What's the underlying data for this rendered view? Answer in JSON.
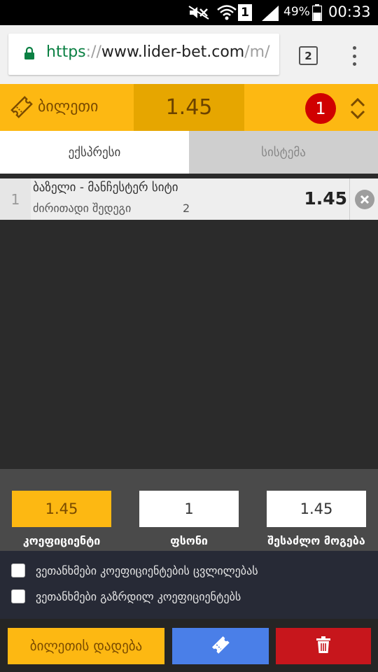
{
  "status_bar": {
    "battery_percent": "49%",
    "time": "00:33",
    "sim_slot": "1"
  },
  "browser": {
    "url_scheme": "https",
    "url_sep": "://",
    "url_host": "www.lider-bet.com",
    "url_path": "/m/",
    "tab_count": "2"
  },
  "ticket": {
    "title": "ბილეთი",
    "total_odds": "1.45",
    "bet_count": "1"
  },
  "tabs": [
    {
      "label": "ექსპრესი",
      "active": true
    },
    {
      "label": "სისტემა",
      "active": false
    }
  ],
  "bets": [
    {
      "number": "1",
      "event": "ბაზელი - მანჩესტერ სიტი",
      "market": "ძირითადი შედეგი",
      "outcome": "2",
      "odds": "1.45"
    }
  ],
  "stake": {
    "coefficient_value": "1.45",
    "coefficient_label": "კოეფიციენტი",
    "stake_value": "1",
    "stake_label": "ფსონი",
    "possible_win_value": "1.45",
    "possible_win_label": "შესაძლო მოგება"
  },
  "options": [
    {
      "label": "ვეთანხმები კოეფიციენტების ცვლილებას",
      "checked": false
    },
    {
      "label": "ვეთანხმები გაზრდილ კოეფიციენტებს",
      "checked": false
    }
  ],
  "actions": {
    "place_bet_label": "ბილეთის დადება"
  },
  "colors": {
    "accent_yellow": "#fdb812",
    "action_blue": "#4a7fe8",
    "danger_red": "#c7161c",
    "badge_red": "#d00000"
  }
}
